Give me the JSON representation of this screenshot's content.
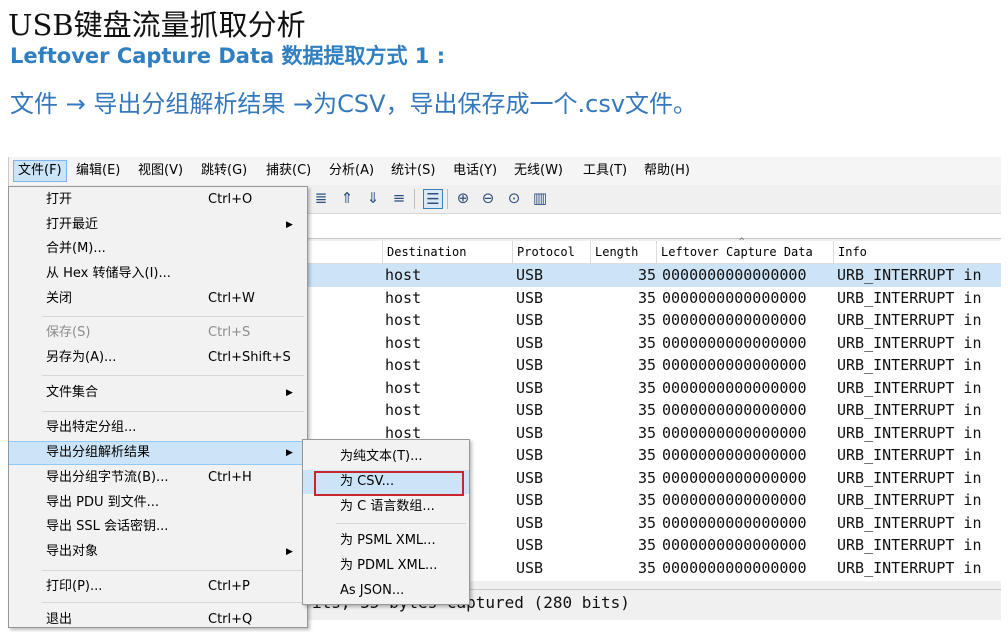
{
  "slide": {
    "title": "USB键盘流量抓取分析",
    "subtitle": "Leftover Capture Data 数据提取方式 1 :",
    "instruction": "文件 → 导出分组解析结果 →为CSV，导出保存成一个.csv文件。"
  },
  "menubar": {
    "items": [
      "文件(F)",
      "编辑(E)",
      "视图(V)",
      "跳转(G)",
      "捕获(C)",
      "分析(A)",
      "统计(S)",
      "电话(Y)",
      "无线(W)",
      "工具(T)",
      "帮助(H)"
    ],
    "active": "文件(F)"
  },
  "toolbar": {
    "icons": [
      "colorize-icon",
      "go-first-icon",
      "go-last-icon",
      "autoscroll-icon",
      "colorize-rows-icon",
      "zoom-in-icon",
      "zoom-out-icon",
      "zoom-reset-icon",
      "resize-columns-icon"
    ]
  },
  "packet_list": {
    "columns": [
      "Destination",
      "Protocol",
      "Length",
      "Leftover Capture Data",
      "Info"
    ],
    "rows": [
      {
        "destination": "host",
        "protocol": "USB",
        "length": "35",
        "data": "0000000000000000",
        "info": "URB_INTERRUPT in",
        "selected": true
      },
      {
        "destination": "host",
        "protocol": "USB",
        "length": "35",
        "data": "0000000000000000",
        "info": "URB_INTERRUPT in"
      },
      {
        "destination": "host",
        "protocol": "USB",
        "length": "35",
        "data": "0000000000000000",
        "info": "URB_INTERRUPT in"
      },
      {
        "destination": "host",
        "protocol": "USB",
        "length": "35",
        "data": "0000000000000000",
        "info": "URB_INTERRUPT in"
      },
      {
        "destination": "host",
        "protocol": "USB",
        "length": "35",
        "data": "0000000000000000",
        "info": "URB_INTERRUPT in"
      },
      {
        "destination": "host",
        "protocol": "USB",
        "length": "35",
        "data": "0000000000000000",
        "info": "URB_INTERRUPT in"
      },
      {
        "destination": "host",
        "protocol": "USB",
        "length": "35",
        "data": "0000000000000000",
        "info": "URB_INTERRUPT in"
      },
      {
        "destination": "host",
        "protocol": "USB",
        "length": "35",
        "data": "0000000000000000",
        "info": "URB_INTERRUPT in"
      },
      {
        "destination": "",
        "protocol": "USB",
        "length": "35",
        "data": "0000000000000000",
        "info": "URB_INTERRUPT in"
      },
      {
        "destination": "",
        "protocol": "USB",
        "length": "35",
        "data": "0000000000000000",
        "info": "URB_INTERRUPT in"
      },
      {
        "destination": "",
        "protocol": "USB",
        "length": "35",
        "data": "0000000000000000",
        "info": "URB_INTERRUPT in"
      },
      {
        "destination": "",
        "protocol": "USB",
        "length": "35",
        "data": "0000000000000000",
        "info": "URB_INTERRUPT in"
      },
      {
        "destination": "",
        "protocol": "USB",
        "length": "35",
        "data": "0000000000000000",
        "info": "URB_INTERRUPT in"
      },
      {
        "destination": "",
        "protocol": "USB",
        "length": "35",
        "data": "0000000000000000",
        "info": "URB_INTERRUPT in"
      }
    ]
  },
  "status_text": "its, 35 bytes captured (280 bits)",
  "file_menu": {
    "items": [
      {
        "label": "打开",
        "shortcut": "Ctrl+O"
      },
      {
        "label": "打开最近",
        "shortcut": "",
        "submenu": true
      },
      {
        "label": "合并(M)...",
        "shortcut": ""
      },
      {
        "label": "从 Hex 转储导入(I)...",
        "shortcut": ""
      },
      {
        "label": "关闭",
        "shortcut": "Ctrl+W"
      },
      {
        "label": "保存(S)",
        "shortcut": "Ctrl+S",
        "disabled": true
      },
      {
        "label": "另存为(A)...",
        "shortcut": "Ctrl+Shift+S"
      },
      {
        "label": "文件集合",
        "shortcut": "",
        "submenu": true
      },
      {
        "label": "导出特定分组...",
        "shortcut": ""
      },
      {
        "label": "导出分组解析结果",
        "shortcut": "",
        "submenu": true,
        "highlighted": true
      },
      {
        "label": "导出分组字节流(B)...",
        "shortcut": "Ctrl+H"
      },
      {
        "label": "导出 PDU 到文件...",
        "shortcut": ""
      },
      {
        "label": "导出 SSL 会话密钥...",
        "shortcut": ""
      },
      {
        "label": "导出对象",
        "shortcut": "",
        "submenu": true
      },
      {
        "label": "打印(P)...",
        "shortcut": "Ctrl+P"
      },
      {
        "label": "退出",
        "shortcut": "Ctrl+Q"
      }
    ],
    "submenu_arrow": "▶"
  },
  "export_submenu": {
    "items": [
      {
        "label": "为纯文本(T)..."
      },
      {
        "label": "为 CSV...",
        "highlighted": true
      },
      {
        "label": "为 C 语言数组..."
      },
      {
        "label": "为 PSML XML..."
      },
      {
        "label": "为 PDML XML..."
      },
      {
        "label": "As JSON..."
      }
    ]
  },
  "colors": {
    "title": "#111111",
    "subtitle": "#2f7fc1",
    "instruction": "#3578bc",
    "selection": "#cce4f7",
    "csv_outline": "#c9252c"
  }
}
